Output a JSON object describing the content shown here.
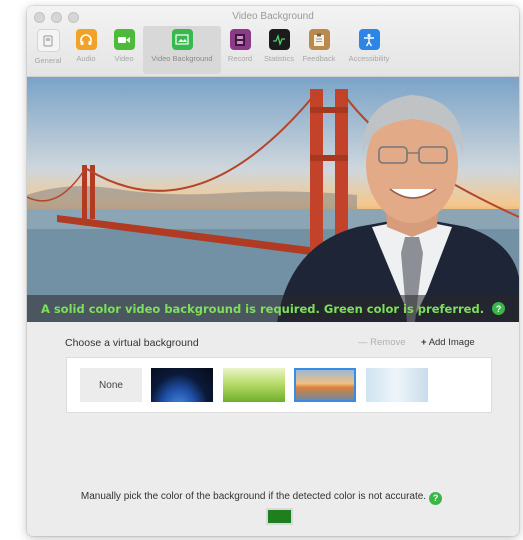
{
  "window": {
    "title": "Video Background"
  },
  "toolbar": {
    "items": [
      {
        "label": "General",
        "icon": "general-icon",
        "color": "#efefef"
      },
      {
        "label": "Audio",
        "icon": "headphones-icon",
        "color": "#f0a229"
      },
      {
        "label": "Video",
        "icon": "video-camera-icon",
        "color": "#4cbb3a"
      },
      {
        "label": "Video Background",
        "icon": "image-icon",
        "color": "#38b84d",
        "selected": true
      },
      {
        "label": "Record",
        "icon": "film-icon",
        "color": "#8a3a86"
      },
      {
        "label": "Statistics",
        "icon": "statistics-icon",
        "color": "#1b1b1b"
      },
      {
        "label": "Feedback",
        "icon": "clipboard-icon",
        "color": "#b98a4c"
      },
      {
        "label": "Accessibility",
        "icon": "accessibility-icon",
        "color": "#2d86e6"
      }
    ]
  },
  "preview": {
    "banner_text": "A solid color video background is required. Green color is preferred.",
    "help_icon": "?"
  },
  "chooser": {
    "label": "Choose a virtual background",
    "remove_label": "Remove",
    "add_label": "Add Image",
    "thumbnails": [
      {
        "label": "None"
      },
      {
        "label": ""
      },
      {
        "label": ""
      },
      {
        "label": "",
        "selected": true
      },
      {
        "label": ""
      }
    ]
  },
  "manual": {
    "text": "Manually pick the color of the background if the detected color is not accurate.",
    "help_icon": "?",
    "swatch_color": "#1f7f1f"
  },
  "colors": {
    "accent_green": "#7ee05a",
    "selection_blue": "#3b8be2"
  }
}
